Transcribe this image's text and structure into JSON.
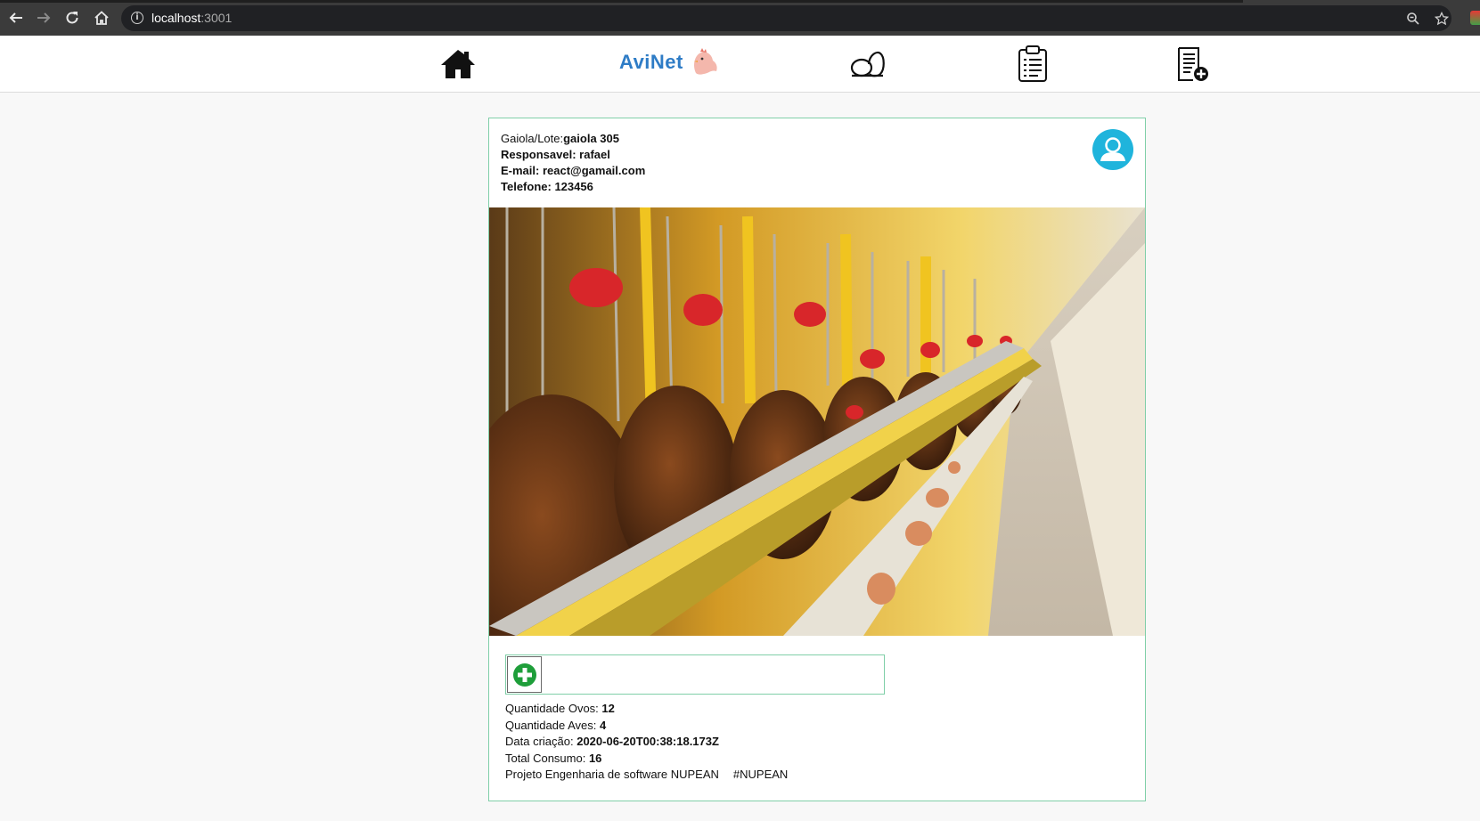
{
  "browser": {
    "url_host": "localhost",
    "url_port": ":3001",
    "back_icon": "arrow-left-icon",
    "forward_icon": "arrow-right-icon",
    "reload_icon": "reload-icon",
    "home_icon": "home-icon"
  },
  "header": {
    "brand": "AviNet",
    "nav_icons": [
      "home-icon",
      "egg-icon",
      "clipboard-icon",
      "add-document-icon"
    ]
  },
  "card": {
    "lote_label": "Gaiola/Lote:",
    "lote_value": "gaiola 305",
    "responsavel_label": "Responsavel:",
    "responsavel_value": "rafael",
    "email_label": "E-mail:",
    "email_value": "react@gamail.com",
    "telefone_label": "Telefone:",
    "telefone_value": "123456",
    "avatar_icon": "user-avatar-icon",
    "add_icon": "plus-circle-icon"
  },
  "stats": {
    "ovos_label": "Quantidade Ovos:",
    "ovos_value": "12",
    "aves_label": "Quantidade Aves:",
    "aves_value": "4",
    "data_label": "Data criação:",
    "data_value": "2020-06-20T00:38:18.173Z",
    "consumo_label": "Total Consumo:",
    "consumo_value": "16",
    "footer_text": "Projeto Engenharia de software NUPEAN",
    "footer_tag": "#NUPEAN"
  },
  "colors": {
    "brand": "#2e7cc6",
    "accent_green": "#80cfa8",
    "avatar_bg": "#1fb4dc",
    "plus_green": "#1e9e3a"
  }
}
